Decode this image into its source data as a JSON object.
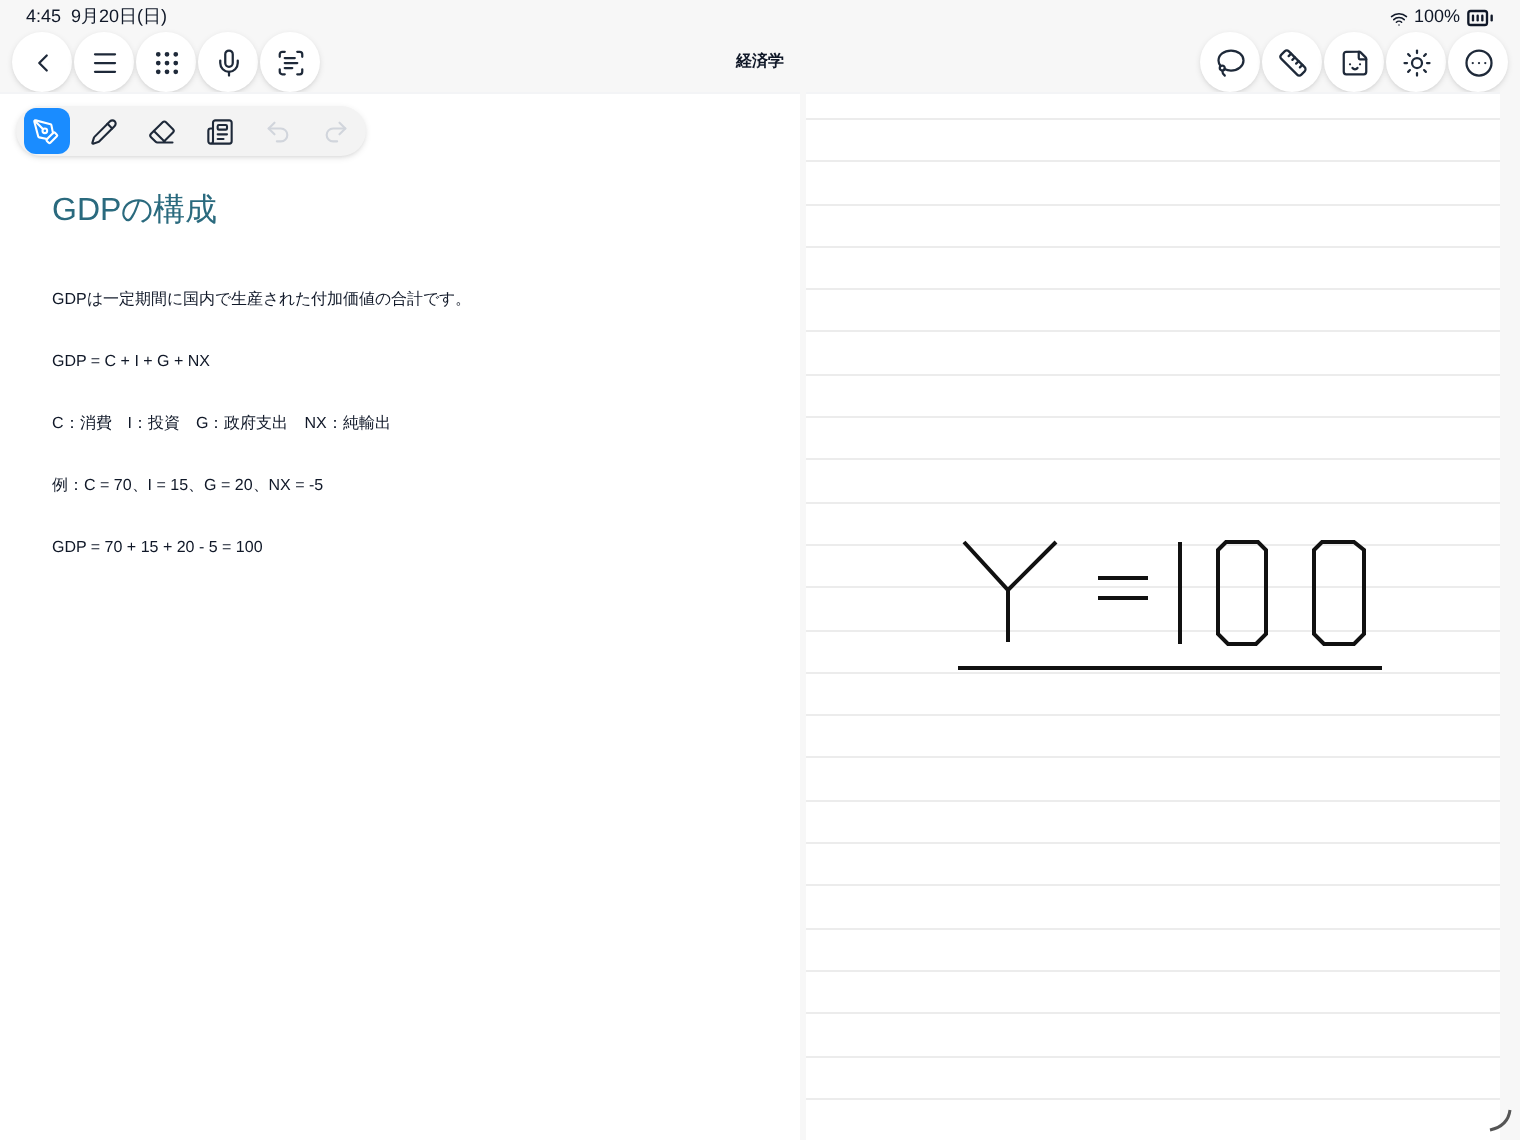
{
  "status_bar": {
    "time": "4:45",
    "date": "9月20日(日)",
    "battery": "100%"
  },
  "window": {
    "title": "経済学"
  },
  "left_buttons": [
    {
      "kind": "back"
    },
    {
      "kind": "menu"
    },
    {
      "kind": "grid"
    },
    {
      "kind": "mic"
    },
    {
      "kind": "scan"
    }
  ],
  "right_buttons": [
    {
      "kind": "lasso"
    },
    {
      "kind": "ruler"
    },
    {
      "kind": "sticker"
    },
    {
      "kind": "burst"
    },
    {
      "kind": "more"
    }
  ],
  "tools": [
    {
      "kind": "pen",
      "selected": true,
      "disabled": false
    },
    {
      "kind": "pencil",
      "selected": false,
      "disabled": false
    },
    {
      "kind": "eraser",
      "selected": false,
      "disabled": false
    },
    {
      "kind": "text",
      "selected": false,
      "disabled": false
    },
    {
      "kind": "undo",
      "selected": false,
      "disabled": true
    },
    {
      "kind": "redo",
      "selected": false,
      "disabled": true
    }
  ],
  "note": {
    "title": "GDPの構成",
    "paragraphs": [
      "GDPは一定期間に国内で生産された付加価値の合計です。",
      "GDP = C + I + G + NX",
      "C：消費　I：投資　G：政府支出　NX：純輸出",
      "例：C = 70、I = 15、G = 20、NX = -5",
      "GDP = 70 + 15 + 20 - 5 = 100"
    ]
  }
}
